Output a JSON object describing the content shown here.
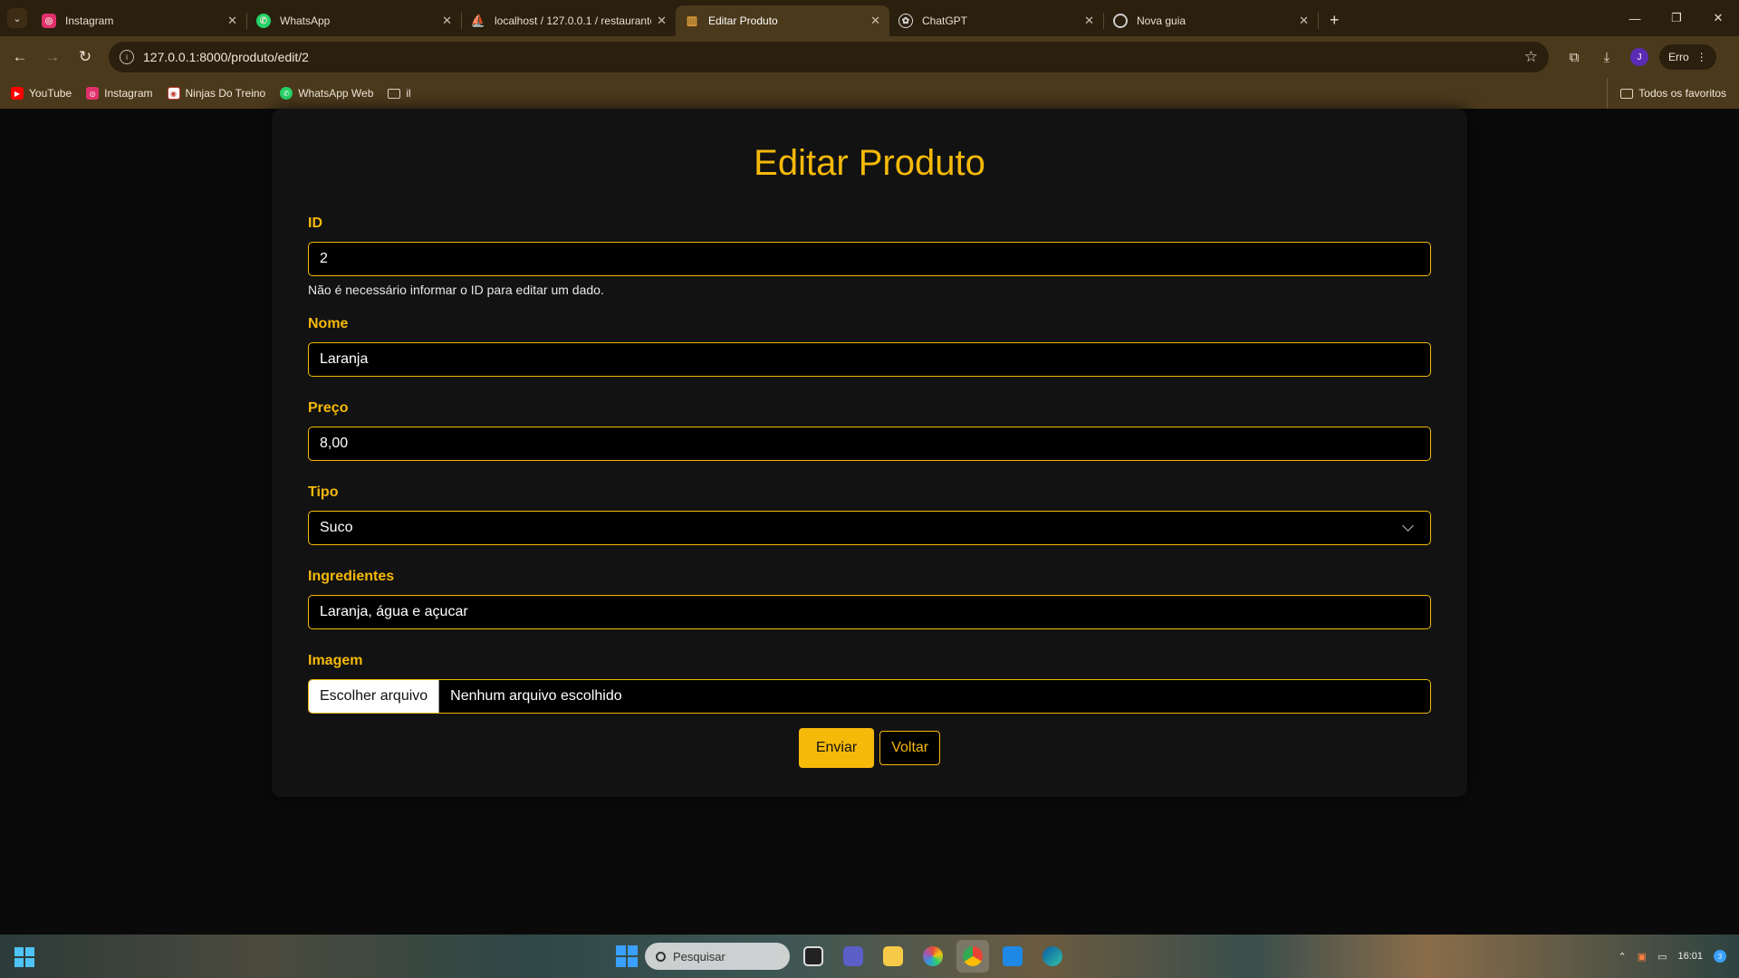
{
  "browser": {
    "tabs": [
      {
        "title": "Instagram",
        "active": false,
        "favicon": "instagram-icon",
        "color": "#e1306c"
      },
      {
        "title": "WhatsApp",
        "active": false,
        "favicon": "whatsapp-icon",
        "color": "#25d366"
      },
      {
        "title": "localhost / 127.0.0.1 / restaurante",
        "active": false,
        "favicon": "phpmyadmin-icon",
        "color": "#f29111"
      },
      {
        "title": "Editar Produto",
        "active": true,
        "favicon": "restaurant-icon",
        "color": "#e8a53c"
      },
      {
        "title": "ChatGPT",
        "active": false,
        "favicon": "chatgpt-icon",
        "color": "#ffffff"
      },
      {
        "title": "Nova guia",
        "active": false,
        "favicon": "chrome-icon",
        "color": "#cccccc"
      }
    ],
    "url": "127.0.0.1:8000/produto/edit/2",
    "profile_initial": "J",
    "profile_status": "Erro",
    "bookmarks": [
      {
        "label": "YouTube",
        "icon": "youtube-icon",
        "color": "#ff0000"
      },
      {
        "label": "Instagram",
        "icon": "instagram-icon",
        "color": "#e1306c"
      },
      {
        "label": "Ninjas Do Treino",
        "icon": "ninja-icon",
        "color": "#c0392b"
      },
      {
        "label": "WhatsApp Web",
        "icon": "whatsapp-icon",
        "color": "#25d366"
      },
      {
        "label": "il",
        "icon": "folder-icon",
        "color": "#e0d6c4"
      }
    ],
    "all_bookmarks_label": "Todos os favoritos"
  },
  "page": {
    "title": "Editar Produto",
    "fields": {
      "id": {
        "label": "ID",
        "value": "2",
        "help": "Não é necessário informar o ID para editar um dado."
      },
      "nome": {
        "label": "Nome",
        "value": "Laranja"
      },
      "preco": {
        "label": "Preço",
        "value": "8,00"
      },
      "tipo": {
        "label": "Tipo",
        "value": "Suco"
      },
      "ingredientes": {
        "label": "Ingredientes",
        "value": "Laranja, água e açucar"
      },
      "imagem": {
        "label": "Imagem",
        "button": "Escolher arquivo",
        "status": "Nenhum arquivo escolhido"
      }
    },
    "submit_label": "Enviar",
    "back_label": "Voltar"
  },
  "taskbar": {
    "search_placeholder": "Pesquisar",
    "time": "16:01",
    "notification_count": "3"
  },
  "colors": {
    "accent": "#f5b90a",
    "page_bg": "#0a0a0a",
    "card_bg": "#121212",
    "browser_frame": "#4b391c"
  }
}
